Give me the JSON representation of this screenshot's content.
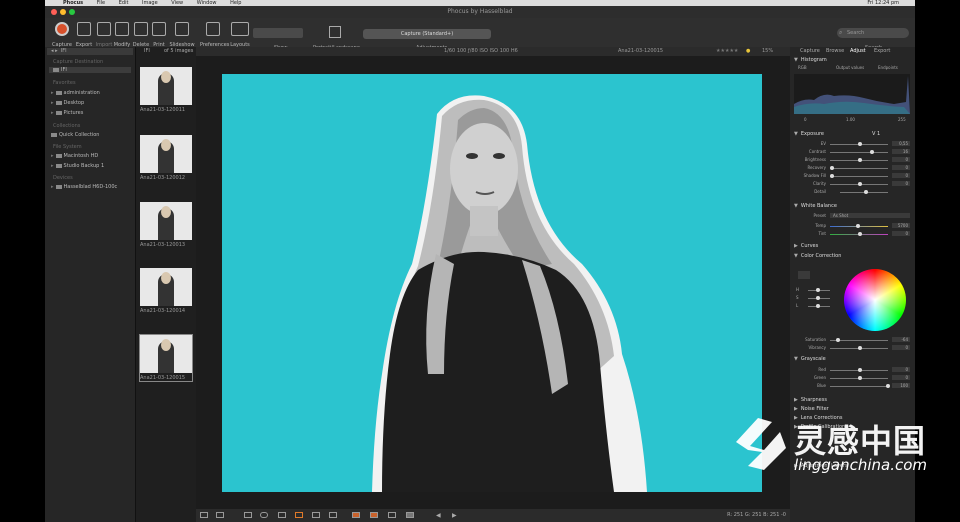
{
  "menubar": {
    "app": "Phocus",
    "items": [
      "File",
      "Edit",
      "Image",
      "View",
      "Window",
      "Help"
    ],
    "clock": "Fri 12:24 pm"
  },
  "window": {
    "title": "Phocus by Hasselblad"
  },
  "toolbar": {
    "buttons": [
      "Capture",
      "Export",
      "Import",
      "Modify",
      "Delete",
      "Print",
      "Slideshow",
      "Preferences",
      "Layouts"
    ],
    "show_label": "Show",
    "orientation_label": "Portrait/Landscape",
    "preset": "Capture (Standard+)",
    "adjustments_label": "Adjustments",
    "search_placeholder": "Search",
    "search_label": "Search"
  },
  "left_panel": {
    "capture_destination_head": "Capture Destination",
    "current_folder": "IFI",
    "favorites_head": "Favorites",
    "favorites": [
      "administration",
      "Desktop",
      "Pictures"
    ],
    "collections_head": "Collections",
    "collections": [
      "Quick Collection"
    ],
    "file_system_head": "File System",
    "file_system": [
      "Macintosh HD",
      "Studio Backup 1"
    ],
    "devices_head": "Devices",
    "devices": [
      "Hasselblad H6D-100c"
    ]
  },
  "browser": {
    "header": "IFI",
    "count": "of 5 images",
    "thumbnails": [
      "Ana21-03-120011",
      "Ana21-03-120012",
      "Ana21-03-120013",
      "Ana21-03-120014",
      "Ana21-03-120015"
    ],
    "selected_index": 4
  },
  "viewer": {
    "exposure_info": "1/60 100   ƒ/80 ISO  ISO 100  H6",
    "filename": "Ana21-03-120015",
    "zoom": "15%",
    "rgb_readout": "R: 251  G: 251  B: 251  -0"
  },
  "right_panel": {
    "tabs": [
      "Capture",
      "Browse",
      "Adjust",
      "Export"
    ],
    "active_tab": "Adjust",
    "histogram": {
      "title": "Histogram",
      "channel": "RGB",
      "clipping_label": "Output values",
      "endpoints_label": "Endpoints",
      "levels": [
        "0",
        "1.00",
        "255"
      ]
    },
    "exposure": {
      "title": "Exposure",
      "version": "V 1",
      "rows": [
        {
          "label": "EV",
          "value": "0,55"
        },
        {
          "label": "Contrast",
          "value": "16"
        },
        {
          "label": "Brightness",
          "value": "0"
        },
        {
          "label": "Recovery",
          "value": "0"
        },
        {
          "label": "Shadow Fill",
          "value": "0"
        },
        {
          "label": "Clarity",
          "value": "0"
        },
        {
          "label": "Detail",
          "value": ""
        }
      ]
    },
    "white_balance": {
      "title": "White Balance",
      "preset_label": "Preset",
      "preset_value": "As Shot",
      "rows": [
        {
          "label": "Temp",
          "value": "5700"
        },
        {
          "label": "Tint",
          "value": "0"
        }
      ]
    },
    "curves": {
      "title": "Curves"
    },
    "color_correction": {
      "title": "Color Correction",
      "hsl_labels": [
        "H",
        "S",
        "L"
      ],
      "rows": [
        {
          "label": "Saturation",
          "value": "-64"
        },
        {
          "label": "Vibrancy",
          "value": "0"
        }
      ]
    },
    "grayscale": {
      "title": "Grayscale",
      "rows": [
        {
          "label": "Red",
          "value": "0"
        },
        {
          "label": "Green",
          "value": "0"
        },
        {
          "label": "Blue",
          "value": "100"
        }
      ]
    },
    "collapsed_sections": [
      "Sharpness",
      "Noise Filter",
      "Lens Corrections",
      "Profile Calibration",
      "Adjustment Layers"
    ]
  },
  "watermark": {
    "text": "灵感中国",
    "url": "lingganchina.com"
  },
  "colors": {
    "photo_background": "#2bc4cf",
    "capture_button": "#d7502b",
    "app_background": "#2a2a2a"
  }
}
